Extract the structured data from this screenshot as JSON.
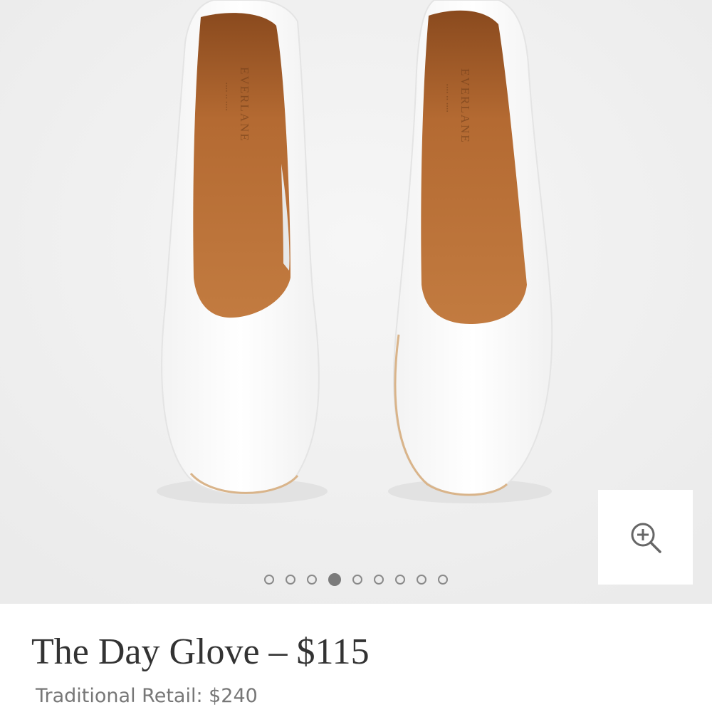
{
  "product": {
    "brand_imprint": "EVERLANE",
    "title": "The Day Glove – $115",
    "traditional_retail": "Traditional Retail: $240"
  },
  "gallery": {
    "total_images": 9,
    "active_index": 3,
    "zoom_icon": "zoom-in-icon"
  },
  "colors": {
    "background": "#efefef",
    "shoe": "#fdfdfd",
    "lining": "#b86d33",
    "title_text": "#333333",
    "retail_text": "#777777",
    "dot": "#8a8a8a"
  }
}
